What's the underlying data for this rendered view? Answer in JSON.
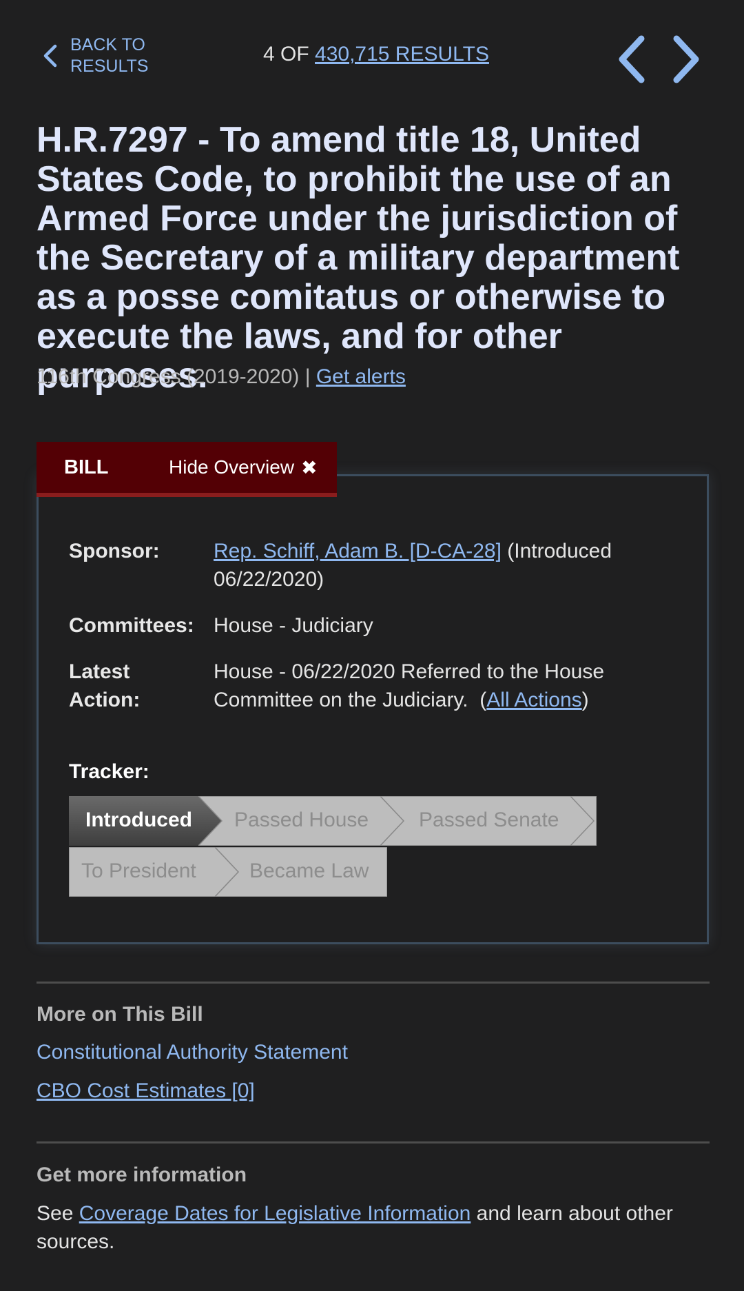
{
  "nav": {
    "back_label": "BACK TO RESULTS",
    "count_prefix": "4 OF",
    "count_link": "430,715 RESULTS"
  },
  "bill": {
    "title": "H.R.7297 - To amend title 18, United States Code, to prohibit the use of an Armed Force under the jurisdiction of the Secretary of a military department as a posse comitatus or otherwise to execute the laws, and for other purposes.",
    "congress": "116th Congress (2019-2020) |",
    "alerts_link": "Get alerts"
  },
  "overview": {
    "tab_label": "BILL",
    "hide_label": "Hide Overview",
    "hide_icon": "✖",
    "sponsor_key": "Sponsor:",
    "sponsor_link": "Rep. Schiff, Adam B. [D-CA-28]",
    "sponsor_note": " (Introduced 06/22/2020)",
    "committees_key": "Committees:",
    "committees_value": "House - Judiciary",
    "latest_key": "Latest Action:",
    "latest_value": "House - 06/22/2020 Referred to the House Committee on the Judiciary.  (",
    "all_actions_link": "All Actions",
    "latest_close": ")",
    "tracker_label": "Tracker:",
    "tracker_steps": [
      "Introduced",
      "Passed House",
      "Passed Senate",
      "To President",
      "Became Law"
    ],
    "tracker_current_index": 0
  },
  "more": {
    "heading": "More on This Bill",
    "constitutional_link": "Constitutional Authority Statement",
    "cbo_link": "CBO Cost Estimates [0]"
  },
  "info": {
    "heading": "Get more information",
    "see": "See ",
    "coverage_link": "Coverage Dates for Legislative Information",
    "rest": " and learn about other sources."
  },
  "colors": {
    "background": "#1f1f20",
    "link": "#8fb8f0",
    "title": "#dfe6fb",
    "tab_bg": "#530005",
    "tracker_active": "#555555",
    "tracker_inactive": "#bdbdbd"
  }
}
